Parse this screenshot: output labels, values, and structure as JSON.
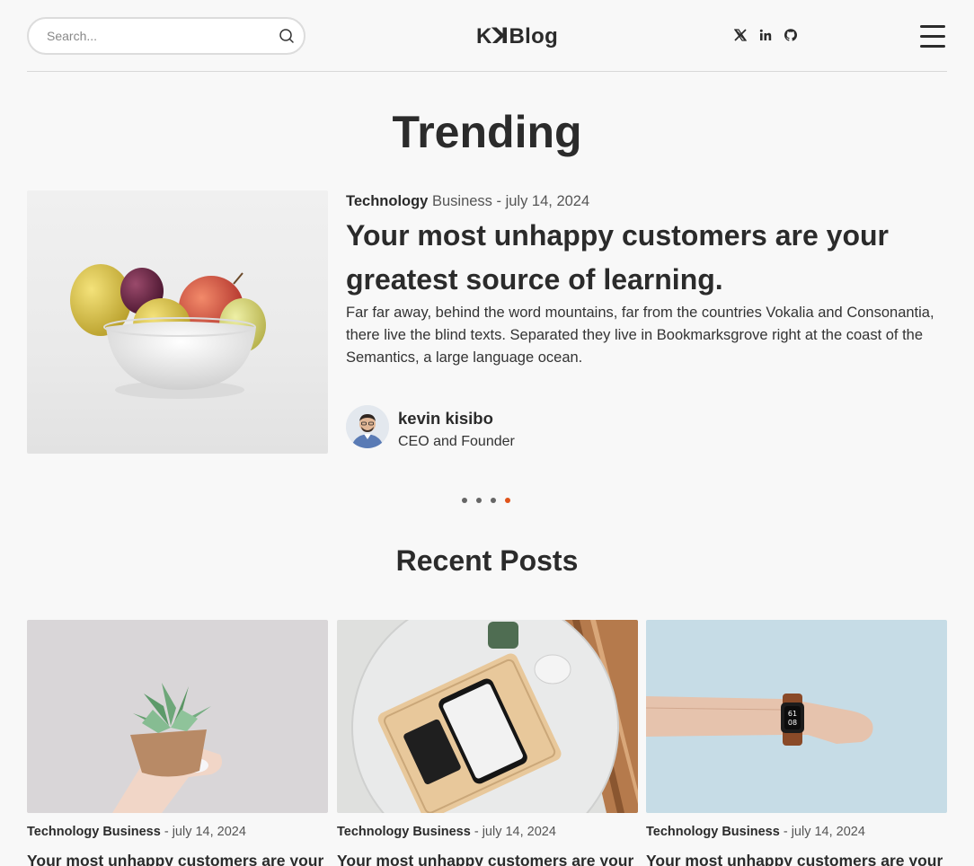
{
  "header": {
    "search_placeholder": "Search...",
    "logo": "KꓘBlog",
    "social": [
      "x-icon",
      "linkedin-icon",
      "github-icon"
    ],
    "menu_icon": "hamburger-menu-icon"
  },
  "trending": {
    "title": "Trending",
    "post": {
      "category_primary": "Technology",
      "category_secondary": "Business",
      "separator": " - ",
      "date": "july 14, 2024",
      "title": "Your most unhappy customers are your greatest source of learning.",
      "excerpt": "Far far away, behind the word mountains, far from the countries Vokalia and Consonantia, there live the blind texts. Separated they live in Bookmarksgrove right at the coast of the Semantics, a large language ocean.",
      "author_name": "kevin kisibo",
      "author_role": "CEO and Founder"
    },
    "slides": 4,
    "active_slide": 4
  },
  "recent": {
    "title": "Recent Posts",
    "posts": [
      {
        "category": "Technology Business",
        "separator": " - ",
        "date": "july 14, 2024",
        "title": "Your most unhappy customers are your greatest source of learning."
      },
      {
        "category": "Technology Business",
        "separator": " - ",
        "date": "july 14, 2024",
        "title": "Your most unhappy customers are your greatest source of learning."
      },
      {
        "category": "Technology Business",
        "separator": " - ",
        "date": "july 14, 2024",
        "title": "Your most unhappy customers are your greatest source of learning."
      }
    ]
  },
  "colors": {
    "accent": "#e0531a",
    "text": "#2b2b2b",
    "background": "#f8f8f8"
  }
}
